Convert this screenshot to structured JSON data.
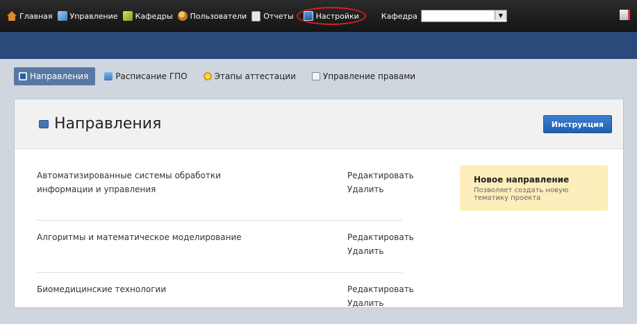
{
  "topnav": {
    "items": [
      {
        "label": "Главная",
        "icon": "home-icon"
      },
      {
        "label": "Управление",
        "icon": "management-icon"
      },
      {
        "label": "Кафедры",
        "icon": "departments-icon"
      },
      {
        "label": "Пользователи",
        "icon": "users-icon"
      },
      {
        "label": "Отчеты",
        "icon": "reports-icon"
      },
      {
        "label": "Настройки",
        "icon": "settings-icon",
        "highlighted": true
      }
    ],
    "kafedra_label": "Кафедра",
    "kafedra_value": "",
    "exit_icon": "exit-icon"
  },
  "tabs": [
    {
      "label": "Направления",
      "icon": "directions-icon",
      "active": true
    },
    {
      "label": "Расписание ГПО",
      "icon": "calendar-icon"
    },
    {
      "label": "Этапы аттестации",
      "icon": "stages-icon"
    },
    {
      "label": "Управление правами",
      "icon": "rights-icon"
    }
  ],
  "panel": {
    "title": "Направления",
    "instruction_button": "Инструкция",
    "rows": [
      {
        "name": "Автоматизированные системы обработки информации и управления",
        "edit": "Редактировать",
        "delete": "Удалить"
      },
      {
        "name": "Алгоритмы и математическое моделирование",
        "edit": "Редактировать",
        "delete": "Удалить"
      },
      {
        "name": "Биомедицинские технологии",
        "edit": "Редактировать",
        "delete": "Удалить"
      }
    ],
    "new_direction": {
      "title": "Новое направление",
      "description": "Позволяет создать новую тематику проекта"
    }
  },
  "colors": {
    "topbar": "#1c1c1c",
    "blue_band": "#2a4a7b",
    "active_tab": "#5878a3",
    "button": "#2a6bbf",
    "highlight_box": "#fdeebb",
    "annotation_circle": "#e21c1c"
  }
}
